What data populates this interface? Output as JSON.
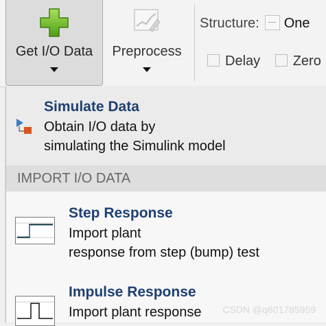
{
  "ribbon": {
    "get_io_label": "Get I/O Data",
    "preprocess_label": "Preprocess",
    "structure_label": "Structure:",
    "structure_value": "One",
    "delay_label": "Delay",
    "zero_label": "Zero"
  },
  "menu": {
    "simulate": {
      "title": "Simulate Data",
      "line1": "Obtain I/O data by",
      "line2": "simulating the Simulink model"
    },
    "section_header": "IMPORT I/O DATA",
    "step": {
      "title": "Step Response",
      "line1": "Import plant",
      "line2": "response from step (bump) test"
    },
    "impulse": {
      "title": "Impulse Response",
      "line1": "Import plant response"
    }
  },
  "watermark": "CSDN @q601785959",
  "colors": {
    "menu_title": "#1e3f73",
    "plus_green": "#6fc02a",
    "sim_icon_blue": "#3b79c6",
    "sim_icon_orange": "#d9541e"
  }
}
